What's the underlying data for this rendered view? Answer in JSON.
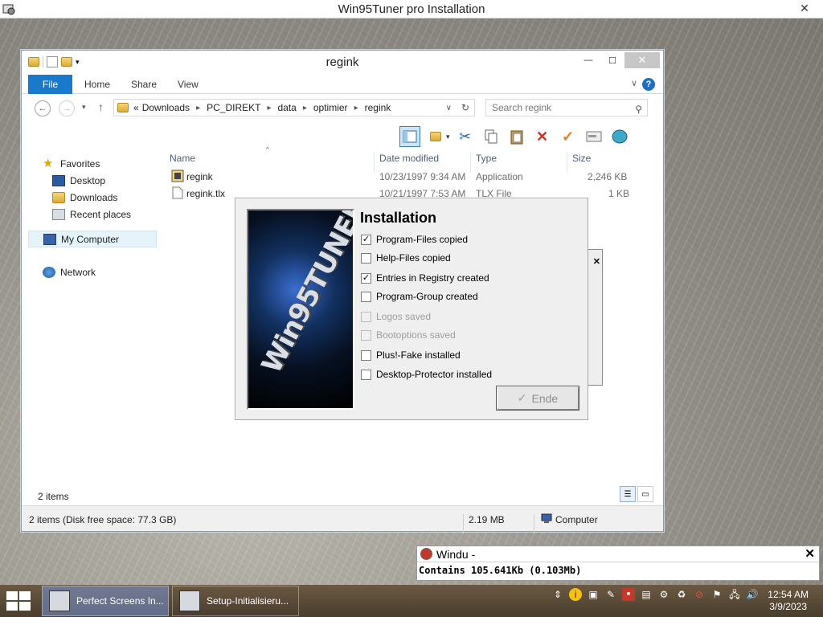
{
  "app": {
    "title": "Win95Tuner pro Installation",
    "close": "✕"
  },
  "explorer": {
    "title": "regink",
    "tabs": [
      "File",
      "Home",
      "Share",
      "View"
    ],
    "address": {
      "overflow": "«",
      "crumbs": [
        "Downloads",
        "PC_DIREKT",
        "data",
        "optimier",
        "regink"
      ]
    },
    "search_placeholder": "Search regink",
    "nav": {
      "favorites": "Favorites",
      "desktop": "Desktop",
      "downloads": "Downloads",
      "recent": "Recent places",
      "mycomputer": "My Computer",
      "network": "Network"
    },
    "columns": {
      "name": "Name",
      "date": "Date modified",
      "type": "Type",
      "size": "Size"
    },
    "files": [
      {
        "name": "regink",
        "date": "10/23/1997 9:34 AM",
        "type": "Application",
        "size": "2,246 KB"
      },
      {
        "name": "regink.tlx",
        "date": "10/21/1997 7:53 AM",
        "type": "TLX File",
        "size": "1 KB"
      }
    ],
    "item_count": "2 items",
    "status": {
      "left": "2 items (Disk free space: 77.3 GB)",
      "size": "2.19 MB",
      "location": "Computer"
    }
  },
  "installer": {
    "heading": "Installation",
    "splash_text": "Win95TUNER",
    "items": [
      {
        "label": "Program-Files copied",
        "checked": true,
        "enabled": true
      },
      {
        "label": "Help-Files copied",
        "checked": false,
        "enabled": true
      },
      {
        "label": "Entries in Registry created",
        "checked": true,
        "enabled": true
      },
      {
        "label": "Program-Group created",
        "checked": false,
        "enabled": true
      },
      {
        "label": "Logos saved",
        "checked": false,
        "enabled": false
      },
      {
        "label": "Bootoptions saved",
        "checked": false,
        "enabled": false
      },
      {
        "label": "Plus!-Fake installed",
        "checked": false,
        "enabled": true
      },
      {
        "label": "Desktop-Protector installed",
        "checked": false,
        "enabled": true
      }
    ],
    "button": "Ende"
  },
  "windu": {
    "title": "Windu -",
    "message": "Contains 105.641Kb (0.103Mb)"
  },
  "taskbar": {
    "tasks": [
      "Perfect Screens In...",
      "Setup-Initialisieru..."
    ],
    "time": "12:54 AM",
    "date": "3/9/2023"
  }
}
